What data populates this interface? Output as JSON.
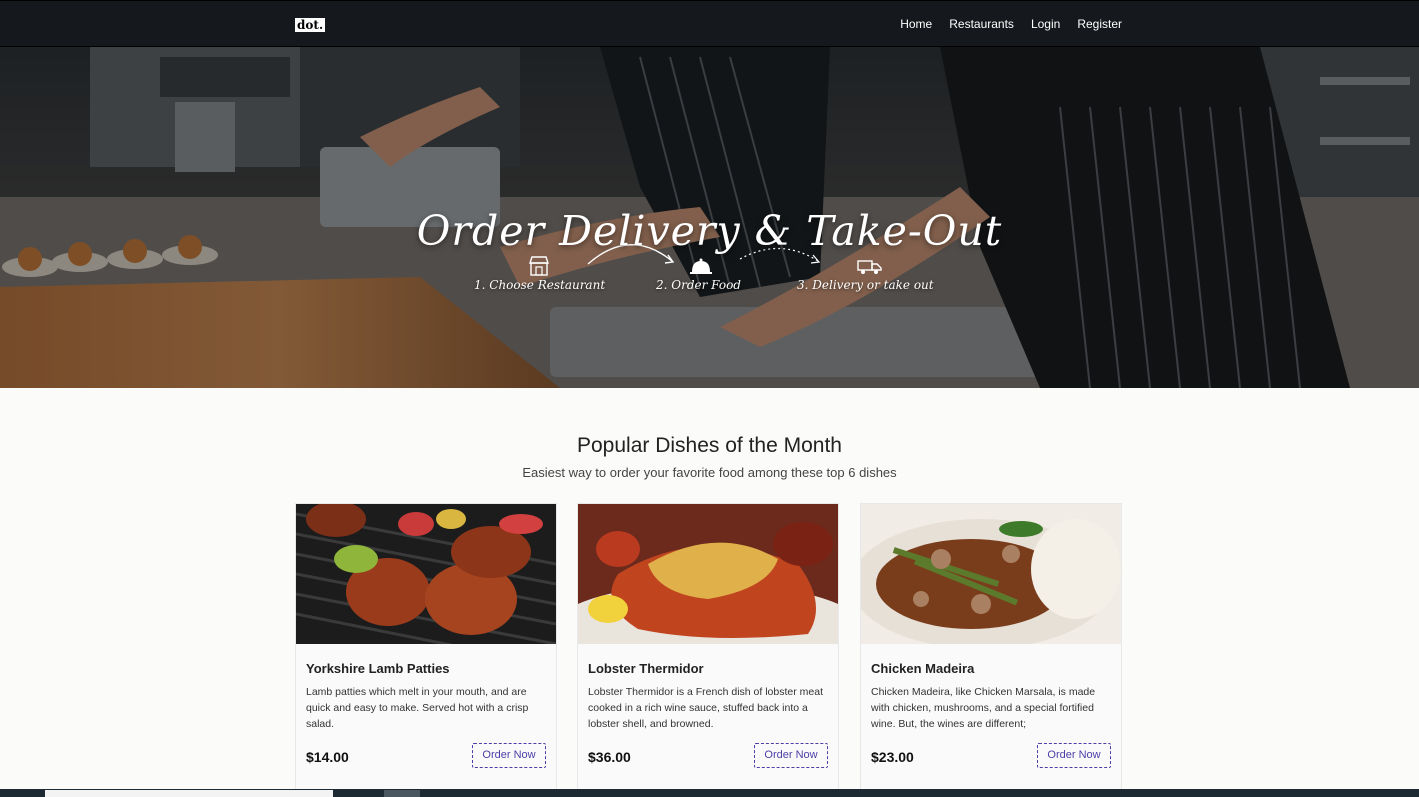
{
  "navbar": {
    "logo": "dot.",
    "links": [
      "Home",
      "Restaurants",
      "Login",
      "Register"
    ]
  },
  "hero": {
    "title": "Order Delivery & Take-Out",
    "steps": [
      {
        "label": "1. Choose Restaurant",
        "icon": "storefront-icon"
      },
      {
        "label": "2. Order Food",
        "icon": "cloche-icon"
      },
      {
        "label": "3. Delivery or take out",
        "icon": "delivery-truck-icon"
      }
    ]
  },
  "popular": {
    "title": "Popular Dishes of the Month",
    "subtitle": "Easiest way to order your favorite food among these top 6 dishes",
    "dishes": [
      {
        "name": "Yorkshire Lamb Patties",
        "description": "Lamb patties which melt in your mouth, and are quick and easy to make. Served hot with a crisp salad.",
        "price": "$14.00",
        "button": "Order Now"
      },
      {
        "name": "Lobster Thermidor",
        "description": "Lobster Thermidor is a French dish of lobster meat cooked in a rich wine sauce, stuffed back into a lobster shell, and browned.",
        "price": "$36.00",
        "button": "Order Now"
      },
      {
        "name": "Chicken Madeira",
        "description": "Chicken Madeira, like Chicken Marsala, is made with chicken, mushrooms, and a special fortified wine. But, the wines are different;",
        "price": "$23.00",
        "button": "Order Now"
      }
    ]
  },
  "colors": {
    "navbar": "#15181d",
    "accent": "#4a3fa6",
    "page_bg": "#fbfbfa"
  }
}
